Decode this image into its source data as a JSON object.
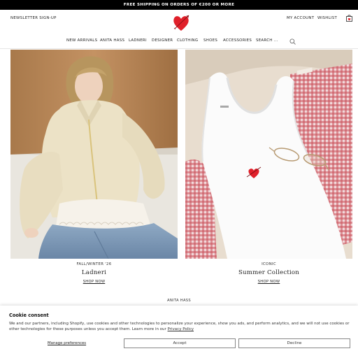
{
  "announcement": "FREE SHIPPING ON ORDERS OF €200 OR MORE",
  "header": {
    "newsletter": "NEWSLETTER SIGN-UP",
    "account": "MY ACCOUNT",
    "wishlist": "WISHLIST",
    "logo_icon": "heart-arrow-logo",
    "bag_icon": "shopping-bag-icon"
  },
  "nav": {
    "items": [
      "NEW ARRIVALS",
      "ANITA HASS",
      "LADNERI",
      "DESIGNER",
      "CLOTHING",
      "SHOES",
      "ACCESSORIES"
    ],
    "search_placeholder": "SEARCH ...",
    "search_icon": "search-icon"
  },
  "features": [
    {
      "overline": "FALL/WINTER '26",
      "title": "Ladneri",
      "link": "SHOP NOW"
    },
    {
      "overline": "ICONIC",
      "title": "Summer Collection",
      "link": "SHOP NOW"
    }
  ],
  "section_label": "ANITA HASS",
  "cookie": {
    "title": "Cookie consent",
    "text": "We and our partners, including Shopify, use cookies and other technologies to personalize your experience, show you ads, and perform analytics, and we will not use cookies or other technologies for these purposes unless you accept them. Learn more in our ",
    "policy_link": "Privacy Policy",
    "manage": "Manage preferences",
    "accept": "Accept",
    "decline": "Decline"
  },
  "colors": {
    "brand_red": "#e0202a",
    "topbar": "#000000"
  }
}
